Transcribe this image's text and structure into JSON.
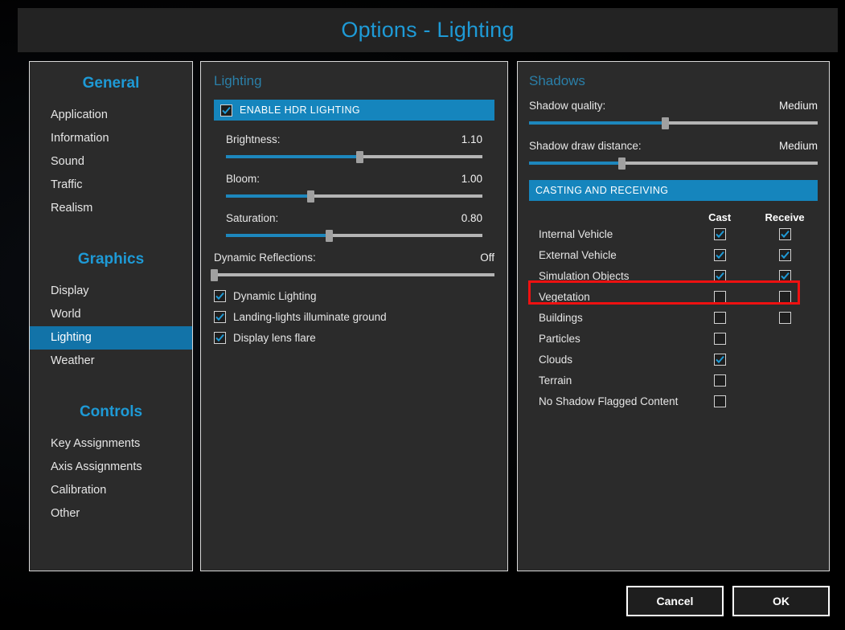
{
  "window": {
    "title": "Options - Lighting",
    "accent_blue": "#1e9ad6",
    "panel_bg": "#2b2b2b",
    "highlight_red": "#ee1111"
  },
  "sidebar": {
    "groups": [
      {
        "title": "General",
        "items": [
          {
            "label": "Application",
            "selected": false
          },
          {
            "label": "Information",
            "selected": false
          },
          {
            "label": "Sound",
            "selected": false
          },
          {
            "label": "Traffic",
            "selected": false
          },
          {
            "label": "Realism",
            "selected": false
          }
        ]
      },
      {
        "title": "Graphics",
        "items": [
          {
            "label": "Display",
            "selected": false
          },
          {
            "label": "World",
            "selected": false
          },
          {
            "label": "Lighting",
            "selected": true
          },
          {
            "label": "Weather",
            "selected": false
          }
        ]
      },
      {
        "title": "Controls",
        "items": [
          {
            "label": "Key Assignments",
            "selected": false
          },
          {
            "label": "Axis Assignments",
            "selected": false
          },
          {
            "label": "Calibration",
            "selected": false
          },
          {
            "label": "Other",
            "selected": false
          }
        ]
      }
    ]
  },
  "lighting": {
    "heading": "Lighting",
    "hdr": {
      "label": "ENABLE HDR LIGHTING",
      "checked": true
    },
    "sliders": [
      {
        "label": "Brightness:",
        "value": "1.10",
        "percent": 52
      },
      {
        "label": "Bloom:",
        "value": "1.00",
        "percent": 33
      },
      {
        "label": "Saturation:",
        "value": "0.80",
        "percent": 40
      }
    ],
    "dynamic_reflections": {
      "label": "Dynamic Reflections:",
      "value": "Off",
      "percent": 0
    },
    "checkboxes": [
      {
        "label": "Dynamic Lighting",
        "checked": true
      },
      {
        "label": "Landing-lights illuminate ground",
        "checked": true
      },
      {
        "label": "Display lens flare",
        "checked": true
      }
    ]
  },
  "shadows": {
    "heading": "Shadows",
    "sliders": [
      {
        "label": "Shadow quality:",
        "value": "Medium",
        "percent": 47
      },
      {
        "label": "Shadow draw distance:",
        "value": "Medium",
        "percent": 32
      }
    ],
    "casting_banner": "CASTING AND RECEIVING",
    "columns": {
      "cast": "Cast",
      "receive": "Receive"
    },
    "rows": [
      {
        "label": "Internal Vehicle",
        "cast": true,
        "receive": true,
        "has_receive": true,
        "highlighted": false
      },
      {
        "label": "External Vehicle",
        "cast": true,
        "receive": true,
        "has_receive": true,
        "highlighted": false
      },
      {
        "label": "Simulation Objects",
        "cast": true,
        "receive": true,
        "has_receive": true,
        "highlighted": false
      },
      {
        "label": "Vegetation",
        "cast": false,
        "receive": false,
        "has_receive": true,
        "highlighted": true
      },
      {
        "label": "Buildings",
        "cast": false,
        "receive": false,
        "has_receive": true,
        "highlighted": false
      },
      {
        "label": "Particles",
        "cast": false,
        "receive": false,
        "has_receive": false,
        "highlighted": false
      },
      {
        "label": "Clouds",
        "cast": true,
        "receive": false,
        "has_receive": false,
        "highlighted": false
      },
      {
        "label": "Terrain",
        "cast": false,
        "receive": false,
        "has_receive": false,
        "highlighted": false
      },
      {
        "label": "No Shadow Flagged Content",
        "cast": false,
        "receive": false,
        "has_receive": false,
        "highlighted": false
      }
    ]
  },
  "footer": {
    "cancel_label": "Cancel",
    "ok_label": "OK"
  }
}
